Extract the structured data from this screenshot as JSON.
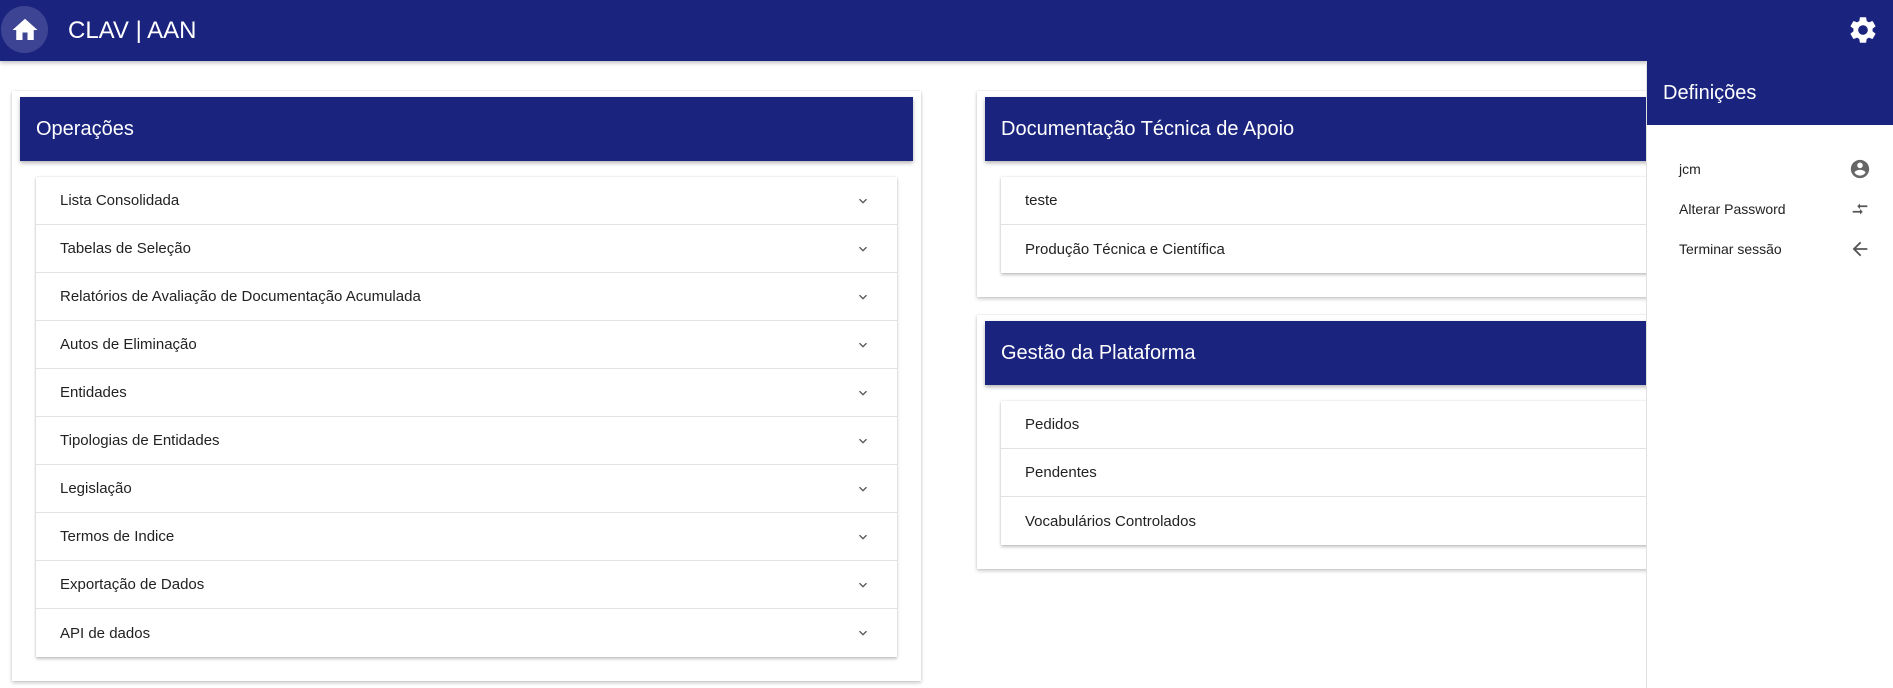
{
  "topbar": {
    "title": "CLAV | AAN",
    "home_icon": "home-icon",
    "settings_icon": "gear-icon",
    "color": "#1a237e"
  },
  "operacoes": {
    "title": "Operações",
    "items": [
      {
        "label": "Lista Consolidada"
      },
      {
        "label": "Tabelas de Seleção"
      },
      {
        "label": "Relatórios de Avaliação de Documentação Acumulada"
      },
      {
        "label": "Autos de Eliminação"
      },
      {
        "label": "Entidades"
      },
      {
        "label": "Tipologias de Entidades"
      },
      {
        "label": "Legislação"
      },
      {
        "label": "Termos de Indice"
      },
      {
        "label": "Exportação de Dados"
      },
      {
        "label": "API de dados"
      }
    ]
  },
  "documentacao": {
    "title": "Documentação Técnica de Apoio",
    "items": [
      {
        "label": "teste"
      },
      {
        "label": "Produção Técnica e Científica"
      }
    ]
  },
  "gestao": {
    "title": "Gestão da Plataforma",
    "items": [
      {
        "label": "Pedidos"
      },
      {
        "label": "Pendentes"
      },
      {
        "label": "Vocabulários Controlados"
      }
    ]
  },
  "drawer": {
    "title": "Definições",
    "items": [
      {
        "label": "jcm",
        "icon": "account-circle-icon"
      },
      {
        "label": "Alterar Password",
        "icon": "swap-arrows-icon"
      },
      {
        "label": "Terminar sessão",
        "icon": "arrow-left-icon"
      }
    ]
  }
}
